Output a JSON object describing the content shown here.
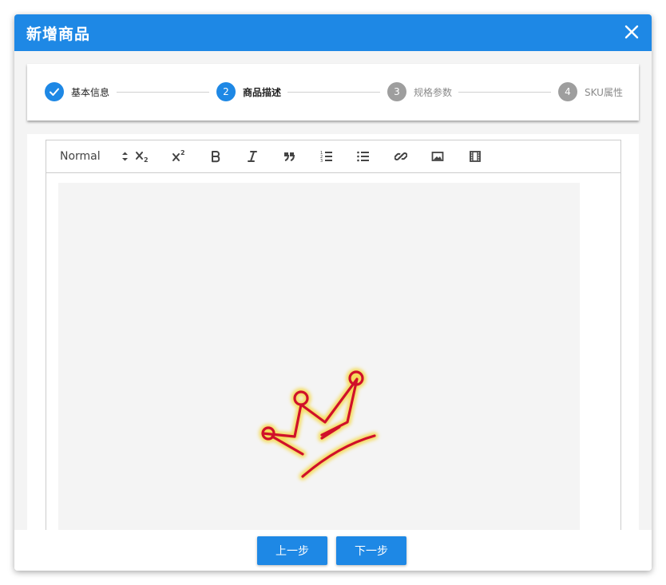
{
  "dialog": {
    "title": "新增商品",
    "close_icon": "close-icon"
  },
  "stepper": {
    "steps": [
      {
        "label": "基本信息",
        "marker": "check-icon",
        "state": "completed"
      },
      {
        "label": "商品描述",
        "number": "2",
        "state": "active"
      },
      {
        "label": "规格参数",
        "number": "3",
        "state": "inactive"
      },
      {
        "label": "SKU属性",
        "number": "4",
        "state": "inactive"
      }
    ]
  },
  "toolbar": {
    "header_select_value": "Normal",
    "buttons": [
      {
        "name": "subscript-button",
        "icon": "subscript-icon"
      },
      {
        "name": "superscript-button",
        "icon": "superscript-icon"
      },
      {
        "name": "bold-button",
        "icon": "bold-icon"
      },
      {
        "name": "italic-button",
        "icon": "italic-icon"
      },
      {
        "name": "blockquote-button",
        "icon": "quote-icon"
      },
      {
        "name": "ordered-list-button",
        "icon": "ordered-list-icon"
      },
      {
        "name": "bullet-list-button",
        "icon": "bullet-list-icon"
      },
      {
        "name": "link-button",
        "icon": "link-icon"
      },
      {
        "name": "image-button",
        "icon": "image-icon"
      },
      {
        "name": "video-button",
        "icon": "video-icon"
      }
    ]
  },
  "editor": {
    "embedded_image": "crown-doodle-image"
  },
  "footer": {
    "prev_label": "上一步",
    "next_label": "下一步"
  },
  "colors": {
    "primary": "#1e88e5",
    "inactive_step": "#9e9e9e",
    "crown_stroke": "#d0102a",
    "crown_glow": "#f5d84a"
  }
}
